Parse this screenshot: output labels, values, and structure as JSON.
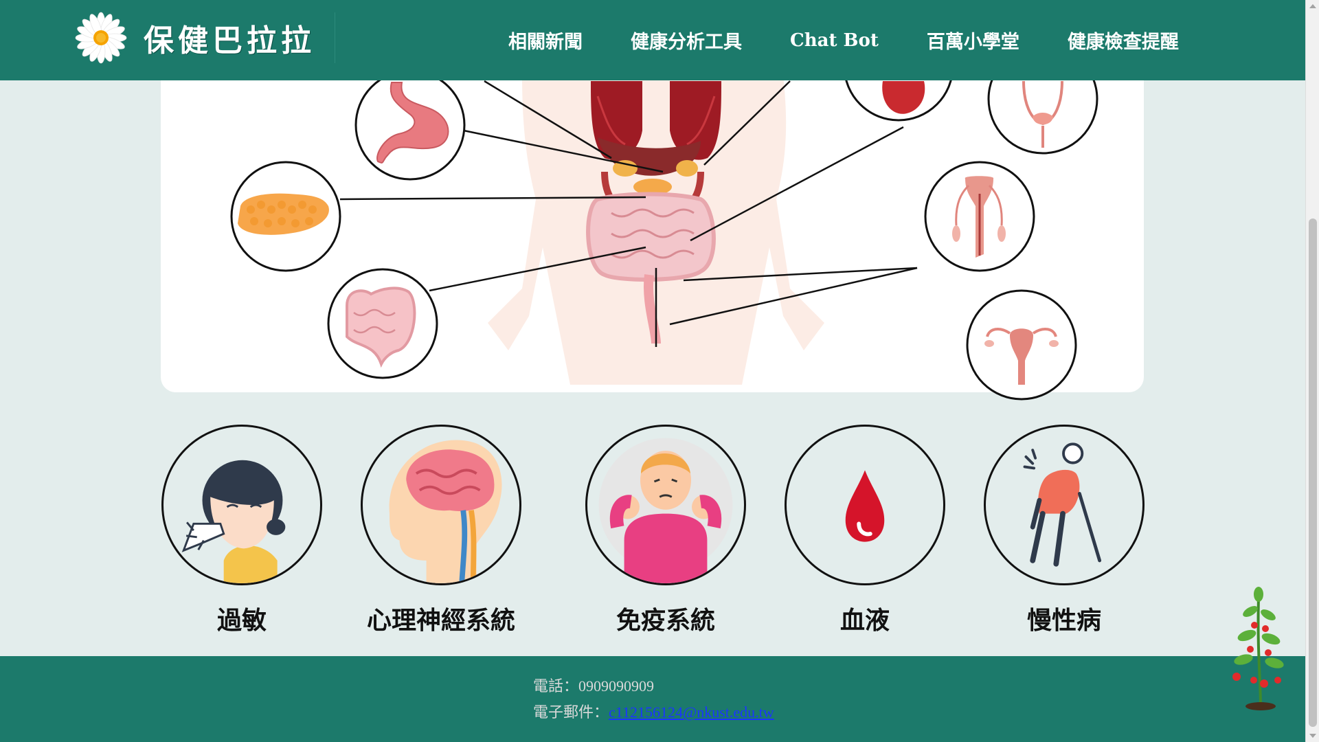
{
  "header": {
    "logo_text": "保健巴拉拉",
    "nav": [
      {
        "label": "相關新聞"
      },
      {
        "label": "健康分析工具"
      },
      {
        "label": "Chat Bot"
      },
      {
        "label": "百萬小學堂"
      },
      {
        "label": "健康檢查提醒"
      }
    ]
  },
  "categories": [
    {
      "label": "過敏",
      "icon": "allergy-icon"
    },
    {
      "label": "心理神經系統",
      "icon": "brain-icon"
    },
    {
      "label": "免疫系統",
      "icon": "immune-icon"
    },
    {
      "label": "血液",
      "icon": "blood-drop-icon"
    },
    {
      "label": "慢性病",
      "icon": "chronic-illness-icon"
    }
  ],
  "footer": {
    "phone": "電話：0909090909",
    "email_label": "電子郵件：",
    "email": "c112156124@nkust.edu.tw"
  },
  "colors": {
    "brand": "#1c7a6b",
    "page_bg": "#e3edec",
    "link": "#1a35ff"
  }
}
